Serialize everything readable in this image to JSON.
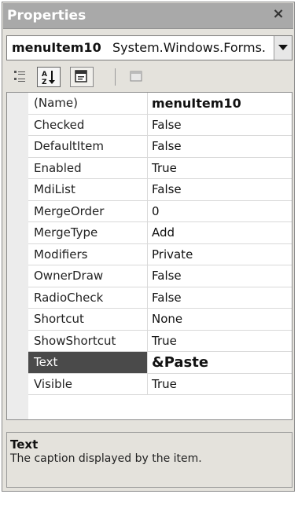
{
  "window": {
    "title": "Properties",
    "close_glyph": "×"
  },
  "object_selector": {
    "name": "menuItem10",
    "type": "System.Windows.Forms.",
    "dropdown_icon": "chevron-down-icon"
  },
  "toolbar": {
    "buttons": [
      {
        "name": "categorized-icon"
      },
      {
        "name": "alphabetical-sort-icon",
        "glyph": "A Z",
        "pressed": true
      },
      {
        "name": "property-pages-icon"
      },
      {
        "name": "events-icon"
      }
    ]
  },
  "properties": [
    {
      "name": "(Name)",
      "value": "menuItem10"
    },
    {
      "name": "Checked",
      "value": "False"
    },
    {
      "name": "DefaultItem",
      "value": "False"
    },
    {
      "name": "Enabled",
      "value": "True"
    },
    {
      "name": "MdiList",
      "value": "False"
    },
    {
      "name": "MergeOrder",
      "value": "0"
    },
    {
      "name": "MergeType",
      "value": "Add"
    },
    {
      "name": "Modifiers",
      "value": "Private"
    },
    {
      "name": "OwnerDraw",
      "value": "False"
    },
    {
      "name": "RadioCheck",
      "value": "False"
    },
    {
      "name": "Shortcut",
      "value": "None"
    },
    {
      "name": "ShowShortcut",
      "value": "True"
    },
    {
      "name": "Text",
      "value": "&Paste"
    },
    {
      "name": "Visible",
      "value": "True"
    }
  ],
  "selected_property": "Text",
  "description": {
    "title": "Text",
    "text": "The caption displayed by the item."
  },
  "colors": {
    "titlebar": "#a9a9a9",
    "panel": "#e4e2dc",
    "selected_row": "#4a4a4a"
  }
}
